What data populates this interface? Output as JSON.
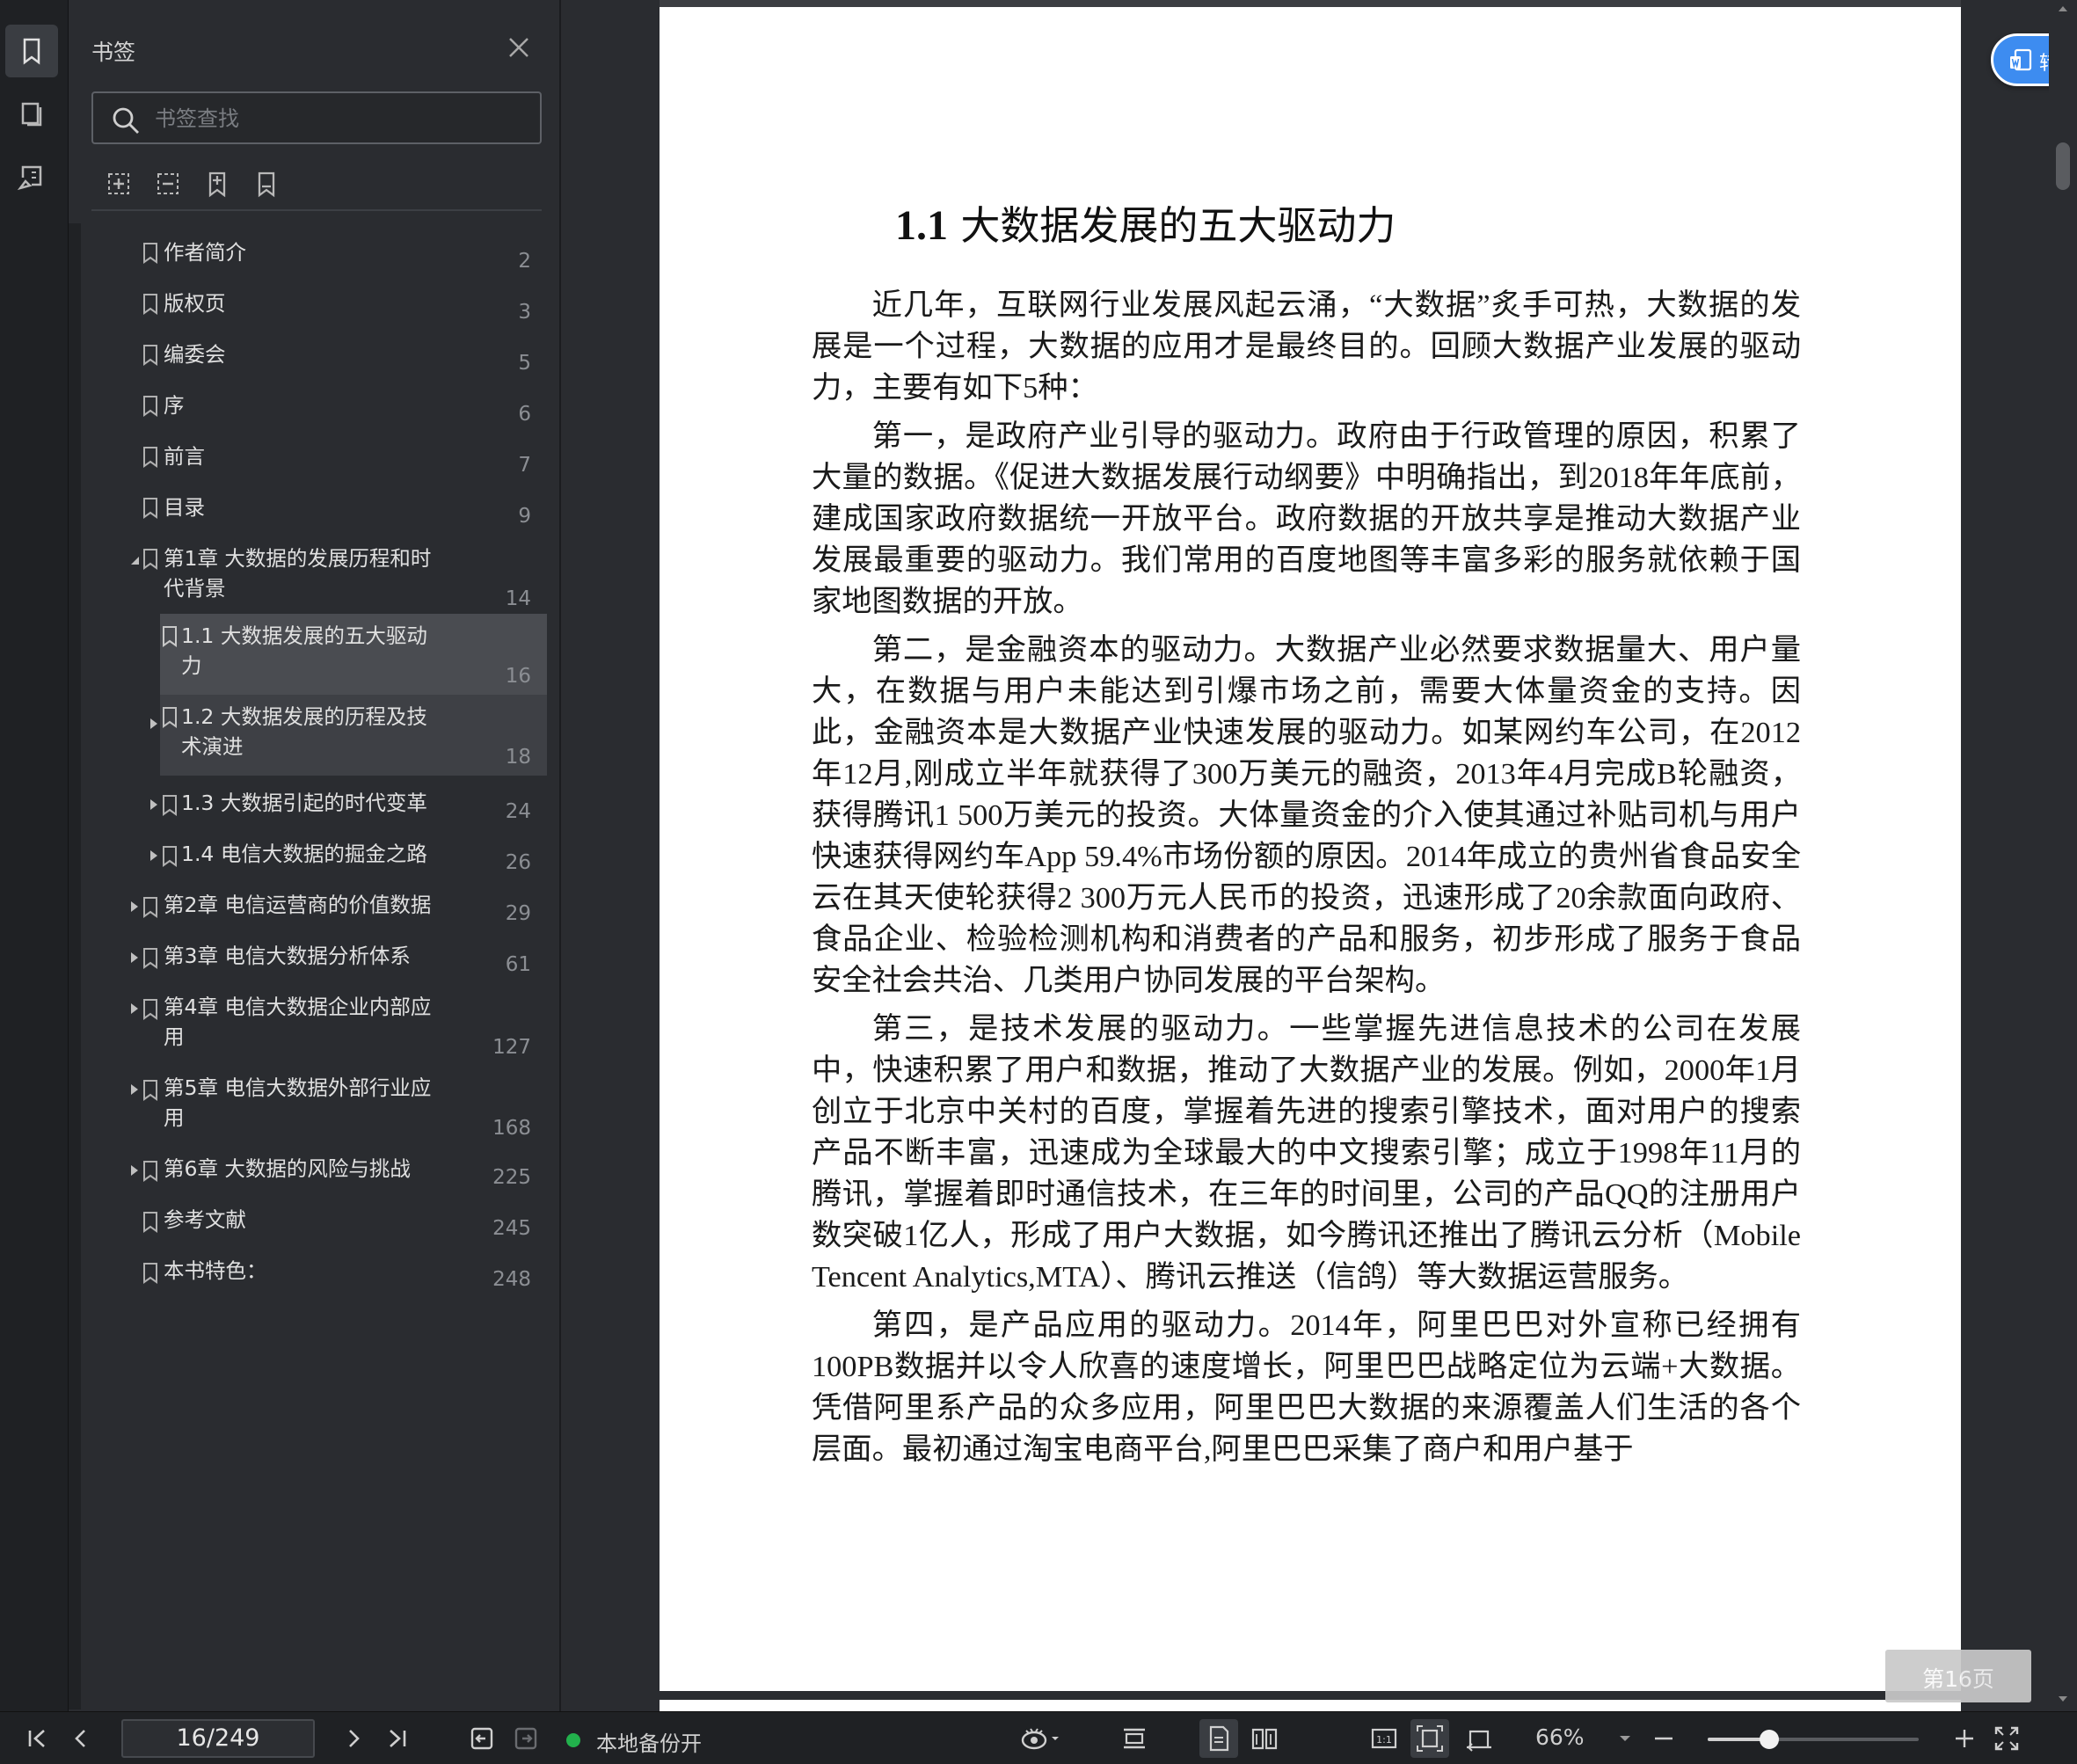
{
  "sidebar": {
    "title": "书签",
    "search_placeholder": "书签查找",
    "bookmarks": [
      {
        "label": "作者简介",
        "page": "2"
      },
      {
        "label": "版权页",
        "page": "3"
      },
      {
        "label": "编委会",
        "page": "5"
      },
      {
        "label": "序",
        "page": "6"
      },
      {
        "label": "前言",
        "page": "7"
      },
      {
        "label": "目录",
        "page": "9"
      },
      {
        "label": "第1章 大数据的发展历程和时代背景",
        "page": "14",
        "expanded": true
      },
      {
        "label": "1.1 大数据发展的五大驱动力",
        "page": "16",
        "selected": true
      },
      {
        "label": "1.2 大数据发展的历程及技术演进",
        "page": "18"
      },
      {
        "label": "1.3 大数据引起的时代变革",
        "page": "24"
      },
      {
        "label": "1.4 电信大数据的掘金之路",
        "page": "26"
      },
      {
        "label": "第2章 电信运营商的价值数据",
        "page": "29"
      },
      {
        "label": "第3章 电信大数据分析体系",
        "page": "61"
      },
      {
        "label": "第4章 电信大数据企业内部应用",
        "page": "127"
      },
      {
        "label": "第5章 电信大数据外部行业应用",
        "page": "168"
      },
      {
        "label": "第6章 大数据的风险与挑战",
        "page": "225"
      },
      {
        "label": "参考文献",
        "page": "245"
      },
      {
        "label": "本书特色：",
        "page": "248"
      }
    ],
    "label_lines": {
      "ch1_l1": "第1章 大数据的发展历程和时",
      "ch1_l2": "代背景",
      "s11_l1": "1.1 大数据发展的五大驱动",
      "s11_l2": "力",
      "s12_l1": "1.2 大数据发展的历程及技",
      "s12_l2": "术演进",
      "ch4_l1": "第4章 电信大数据企业内部应",
      "ch4_l2": "用",
      "ch5_l1": "第5章 电信大数据外部行业应",
      "ch5_l2": "用"
    }
  },
  "document": {
    "heading_num": "1.1",
    "heading_text": "大数据发展的五大驱动力",
    "paragraphs": [
      "近几年，互联网行业发展风起云涌，“大数据”炙手可热，大数据的发展是一个过程，大数据的应用才是最终目的。回顾大数据产业发展的驱动力，主要有如下5种：",
      "第一，是政府产业引导的驱动力。政府由于行政管理的原因，积累了大量的数据。《促进大数据发展行动纲要》中明确指出，到2018年年底前，建成国家政府数据统一开放平台。政府数据的开放共享是推动大数据产业发展最重要的驱动力。我们常用的百度地图等丰富多彩的服务就依赖于国家地图数据的开放。",
      "第二，是金融资本的驱动力。大数据产业必然要求数据量大、用户量大，在数据与用户未能达到引爆市场之前，需要大体量资金的支持。因此，金融资本是大数据产业快速发展的驱动力。如某网约车公司，在2012年12月,刚成立半年就获得了300万美元的融资，2013年4月完成B轮融资，获得腾讯1 500万美元的投资。大体量资金的介入使其通过补贴司机与用户快速获得网约车App 59.4%市场份额的原因。2014年成立的贵州省食品安全云在其天使轮获得2 300万元人民币的投资，迅速形成了20余款面向政府、食品企业、检验检测机构和消费者的产品和服务，初步形成了服务于食品安全社会共治、几类用户协同发展的平台架构。",
      "第三，是技术发展的驱动力。一些掌握先进信息技术的公司在发展中，快速积累了用户和数据，推动了大数据产业的发展。例如，2000年1月创立于北京中关村的百度，掌握着先进的搜索引擎技术，面对用户的搜索产品不断丰富，迅速成为全球最大的中文搜索引擎；成立于1998年11月的腾讯，掌握着即时通信技术，在三年的时间里，公司的产品QQ的注册用户数突破1亿人，形成了用户大数据，如今腾讯还推出了腾讯云分析（Mobile Tencent Analytics,MTA）、腾讯云推送（信鸽）等大数据运营服务。",
      "第四，是产品应用的驱动力。2014年，阿里巴巴对外宣称已经拥有100PB数据并以令人欣喜的速度增长，阿里巴巴战略定位为云端+大数据。凭借阿里系产品的众多应用，阿里巴巴大数据的来源覆盖人们生活的各个层面。最初通过淘宝电商平台,阿里巴巴采集了商户和用户基于"
    ],
    "convert_button": "转为Word",
    "page_badge": "第16页"
  },
  "statusbar": {
    "page_indicator": "16/249",
    "backup_status": "本地备份开",
    "zoom": "66%",
    "zoom_fraction": 0.29
  },
  "colors": {
    "accent": "#3d8cf0",
    "backup_on": "#22b14c",
    "selection": "#4a4c51"
  },
  "icons": [
    "bookmark-icon",
    "thumbnail-icon",
    "annotation-icon",
    "close-icon",
    "search-icon",
    "expand-all-icon",
    "collapse-all-icon",
    "add-bookmark-icon",
    "bookmark-outline-icon",
    "first-page-icon",
    "prev-page-icon",
    "next-page-icon",
    "last-page-icon",
    "back-icon",
    "forward-icon",
    "eye-icon",
    "single-page-icon",
    "page-icon",
    "two-page-icon",
    "actual-size-icon",
    "fit-page-icon",
    "fit-width-icon",
    "zoom-out-icon",
    "zoom-in-icon",
    "fullscreen-icon"
  ]
}
